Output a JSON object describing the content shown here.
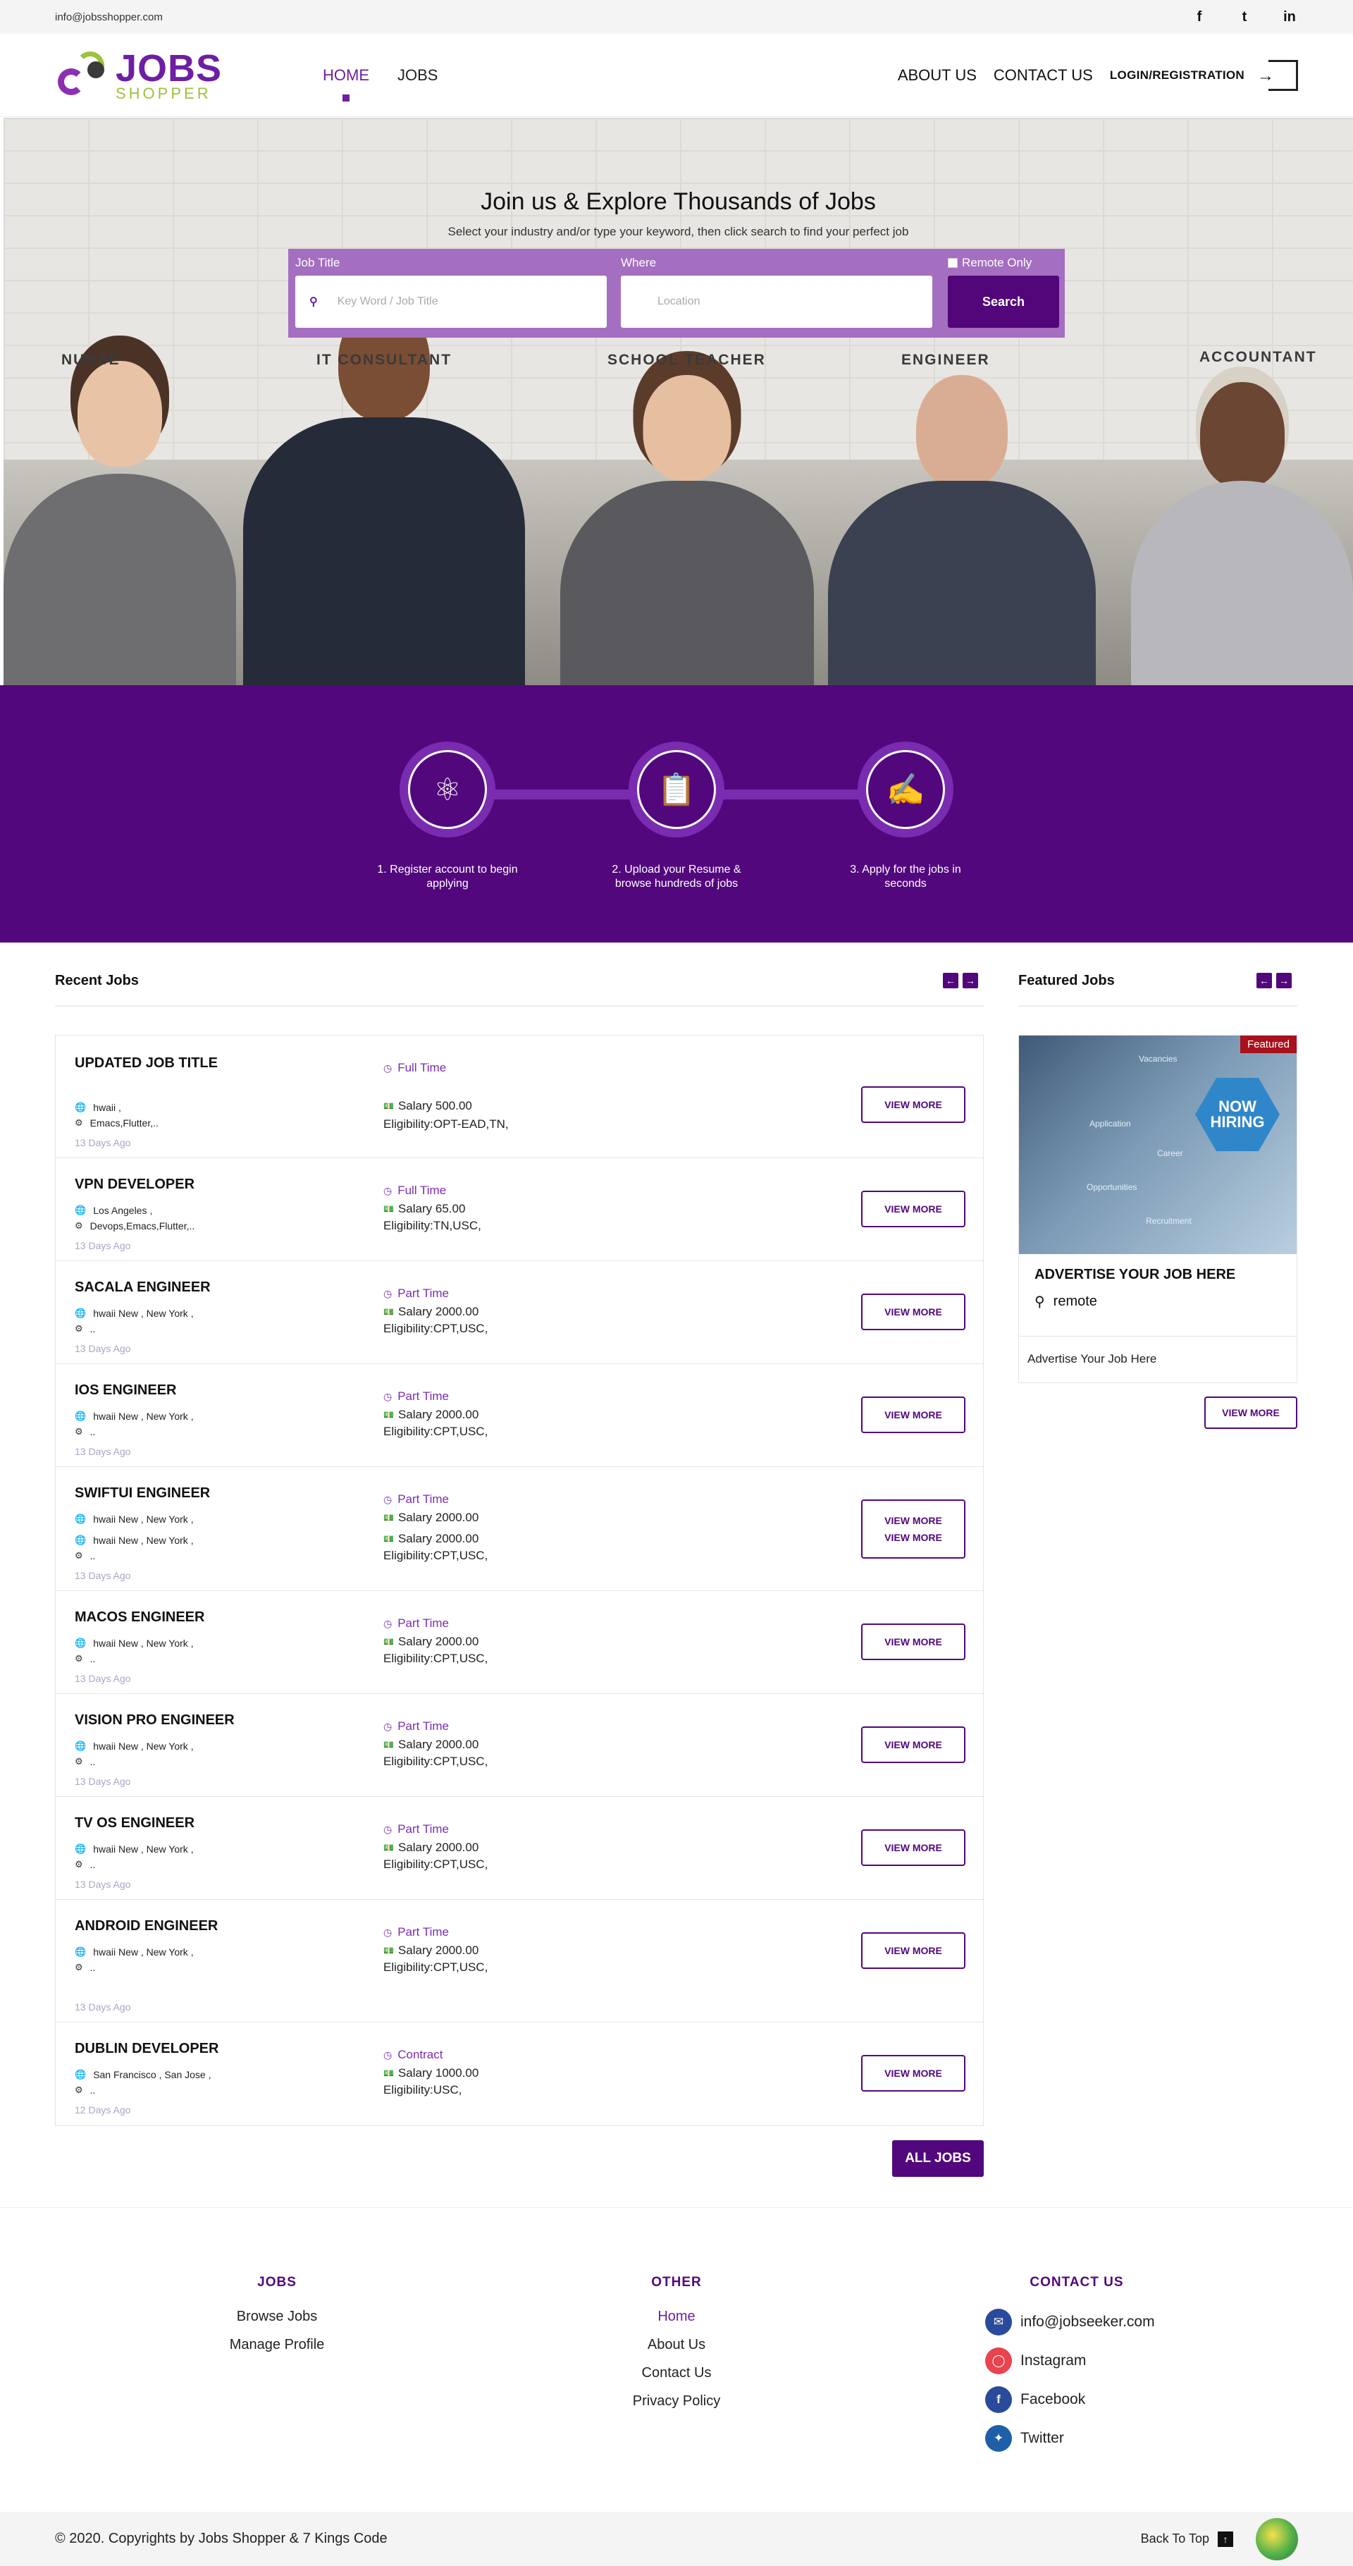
{
  "topbar": {
    "email": "info@jobsshopper.com",
    "socials": [
      {
        "icon": "facebook-icon",
        "glyph": "f"
      },
      {
        "icon": "twitter-icon",
        "glyph": "t"
      },
      {
        "icon": "linkedin-icon",
        "glyph": "in"
      }
    ]
  },
  "brand": {
    "word": "JOBS",
    "sub": "SHOPPER"
  },
  "nav": {
    "left": [
      {
        "label": "HOME",
        "active": true
      },
      {
        "label": "JOBS",
        "active": false
      }
    ],
    "about": "ABOUT US",
    "contact": "CONTACT US",
    "login": "LOGIN/REGISTRATION"
  },
  "hero": {
    "title": "Join us & Explore Thousands of Jobs",
    "subtitle": "Select your industry and/or type your keyword, then click search to find your perfect job",
    "roles": [
      "NURSE",
      "IT CONSULTANT",
      "SCHOOL TEACHER",
      "ENGINEER",
      "ACCOUNTANT"
    ],
    "search": {
      "job_title_label": "Job Title",
      "job_title_placeholder": "Key Word / Job Title",
      "where_label": "Where",
      "where_placeholder": "Location",
      "remote_label": "Remote Only",
      "button": "Search"
    }
  },
  "steps": [
    {
      "icon": "atom-icon",
      "text": "1. Register account to begin applying"
    },
    {
      "icon": "resume-clipboard-icon",
      "text": "2. Upload your Resume & browse hundreds of jobs"
    },
    {
      "icon": "apply-hand-icon",
      "text": "3. Apply for the jobs in seconds"
    }
  ],
  "recent": {
    "title": "Recent Jobs",
    "view_more": "VIEW MORE",
    "all_jobs": "ALL JOBS",
    "jobs": [
      {
        "title": "UPDATED JOB TITLE",
        "location": "hwaii ,",
        "skills": "Emacs,Flutter,..",
        "ago": "13 Days Ago",
        "type": "Full Time",
        "salary": "Salary  500.00",
        "eligibility": "Eligibility:OPT-EAD,TN,"
      },
      {
        "title": "VPN DEVELOPER",
        "location": "Los Angeles ,",
        "skills": "Devops,Emacs,Flutter,..",
        "ago": "13 Days Ago",
        "type": "Full Time",
        "salary": "Salary  65.00",
        "eligibility": "Eligibility:TN,USC,"
      },
      {
        "title": "SACALA ENGINEER",
        "location": "hwaii New ,   New York ,",
        "skills": "..",
        "ago": "13 Days Ago",
        "type": "Part Time",
        "salary": "Salary  2000.00",
        "eligibility": "Eligibility:CPT,USC,"
      },
      {
        "title": "IOS ENGINEER",
        "location": "hwaii New ,   New York ,",
        "skills": "..",
        "ago": "13 Days Ago",
        "type": "Part Time",
        "salary": "Salary  2000.00",
        "eligibility": "Eligibility:CPT,USC,"
      },
      {
        "title": "SWIFTUI ENGINEER",
        "location": "hwaii New ,   New York ,",
        "skills": "..",
        "ago": "13 Days Ago",
        "type": "Part Time",
        "salary": "Salary  2000.00",
        "eligibility": "Eligibility:CPT,USC,"
      },
      {
        "title": "MACOS ENGINEER",
        "location": "hwaii New ,   New York ,",
        "skills": "..",
        "ago": "13 Days Ago",
        "type": "Part Time",
        "salary": "Salary  2000.00",
        "eligibility": "Eligibility:CPT,USC,"
      },
      {
        "title": "VISION PRO ENGINEER",
        "location": "hwaii New ,   New York ,",
        "skills": "..",
        "ago": "13 Days Ago",
        "type": "Part Time",
        "salary": "Salary  2000.00",
        "eligibility": "Eligibility:CPT,USC,"
      },
      {
        "title": "TV OS ENGINEER",
        "location": "hwaii New ,   New York ,",
        "skills": "..",
        "ago": "13 Days Ago",
        "type": "Part Time",
        "salary": "Salary  2000.00",
        "eligibility": "Eligibility:CPT,USC,"
      },
      {
        "title": "ANDROID ENGINEER",
        "location": "hwaii New ,   New York ,",
        "skills": "..",
        "ago": "13 Days Ago",
        "type": "Part Time",
        "salary": "Salary  2000.00",
        "eligibility": "Eligibility:CPT,USC,"
      },
      {
        "title": "DUBLIN DEVELOPER",
        "location": "San Francisco ,   San Jose ,",
        "skills": "..",
        "ago": "12 Days Ago",
        "type": "Contract",
        "salary": "Salary  1000.00",
        "eligibility": "Eligibility:USC,"
      }
    ]
  },
  "featured": {
    "title": "Featured Jobs",
    "badge": "Featured",
    "image_headline": "NOW HIRING",
    "image_words": [
      "Application",
      "Career",
      "Opportunities",
      "Recruitment",
      "Vacancies"
    ],
    "job_title": "ADVERTISE YOUR JOB HERE",
    "location": "remote",
    "description": "Advertise Your Job Here",
    "view_more": "VIEW MORE"
  },
  "footer": {
    "jobs": {
      "heading": "JOBS",
      "links": [
        "Browse Jobs",
        "Manage Profile"
      ]
    },
    "other": {
      "heading": "OTHER",
      "links": [
        "Home",
        "About Us",
        "Contact Us",
        "Privacy Policy"
      ]
    },
    "contact": {
      "heading": "CONTACT US",
      "items": [
        {
          "icon": "email-icon",
          "label": "info@jobseeker.com",
          "color": "#2a4a9c"
        },
        {
          "icon": "instagram-icon",
          "label": "Instagram",
          "color": "#e8434f"
        },
        {
          "icon": "facebook-icon",
          "label": "Facebook",
          "color": "#2a4a9c"
        },
        {
          "icon": "twitter-icon",
          "label": "Twitter",
          "color": "#1e5fa8"
        }
      ]
    },
    "copyright": "© 2020. Copyrights by Jobs Shopper & 7 Kings Code",
    "back_to_top": "Back To Top"
  },
  "colors": {
    "brand_purple": "#52077d",
    "accent_purple": "#6d1fa3",
    "brand_green": "#9bc33b"
  }
}
